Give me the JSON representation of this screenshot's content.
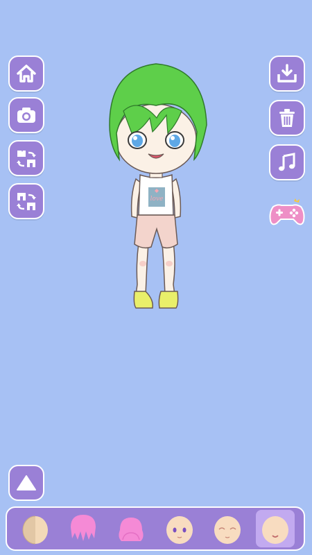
{
  "app": {
    "background_color": "#a7c1f4",
    "button_color": "#9a80d6"
  },
  "left_toolbar": {
    "buttons": [
      {
        "icon": "home-icon"
      },
      {
        "icon": "camera-icon"
      },
      {
        "icon": "swap-top-icon"
      },
      {
        "icon": "swap-bottom-icon"
      }
    ]
  },
  "right_toolbar": {
    "buttons": [
      {
        "icon": "download-icon"
      },
      {
        "icon": "trash-icon"
      },
      {
        "icon": "music-icon"
      },
      {
        "icon": "gamepad-icon"
      }
    ]
  },
  "character": {
    "hair_color": "#5ecf4a",
    "shirt_text": "love",
    "shorts_color": "#f3d4cc",
    "shoes_color": "#e9ef6a"
  },
  "bottom_tabs": {
    "items": [
      {
        "icon": "skin-tone-icon",
        "selected": false
      },
      {
        "icon": "front-hair-icon",
        "selected": false
      },
      {
        "icon": "back-hair-icon",
        "selected": false
      },
      {
        "icon": "eyes-icon",
        "selected": false
      },
      {
        "icon": "eyebrows-icon",
        "selected": false
      },
      {
        "icon": "mouth-icon",
        "selected": true
      }
    ]
  },
  "expand_button": {
    "icon": "triangle-up-icon"
  }
}
